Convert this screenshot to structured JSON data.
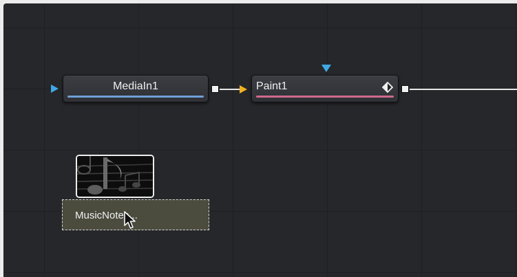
{
  "flow": {
    "nodes": [
      {
        "label": "MediaIn1",
        "bar_color": "#6f9fd8"
      },
      {
        "label": "Paint1",
        "bar_color": "#d06b8c"
      }
    ],
    "drop_clip": {
      "label": "MusicNotes..."
    }
  },
  "colors": {
    "canvas": "#26272a",
    "input_triangle_blue": "#3fa9e6",
    "input_triangle_yellow": "#f0b21e",
    "connection_line": "#e8e8e8"
  },
  "icons": [
    "input-triangle-icon",
    "output-port-icon",
    "keyframe-diamond-icon",
    "cursor-arrow-icon"
  ]
}
